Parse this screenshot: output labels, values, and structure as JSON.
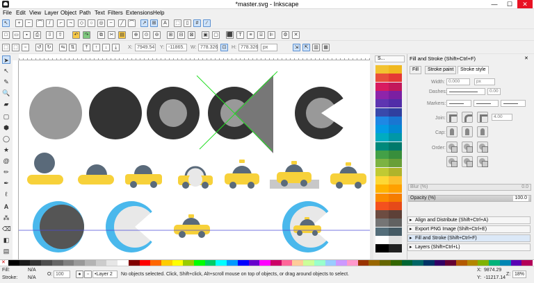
{
  "window": {
    "title": "*master.svg - Inkscape",
    "minimize": "—",
    "maximize": "☐",
    "close": "✕"
  },
  "menubar": [
    "File",
    "Edit",
    "View",
    "Layer",
    "Object",
    "Path",
    "Text",
    "Filters",
    "Extensions",
    "Help"
  ],
  "toolcontrols": {
    "x_label": "X:",
    "x_value": "7949.54",
    "y_label": "Y:",
    "y_value": "-11865.",
    "w_label": "W:",
    "w_value": "778.326",
    "h_label": "H:",
    "h_value": "778.326",
    "unit": "px"
  },
  "panel": {
    "header": "Fill and Stroke (Shift+Ctrl+F)",
    "tabs": [
      "Fill",
      "Stroke paint",
      "Stroke style"
    ],
    "active_tab": "Stroke style",
    "width_label": "Width:",
    "width_value": "0.000",
    "width_unit": "px",
    "dashes_label": "Dashes:",
    "dashes_value": "0.00",
    "markers_label": "Markers:",
    "join_label": "Join:",
    "join_value": "4.00",
    "cap_label": "Cap:",
    "order_label": "Order:",
    "blur_label": "Blur (%)",
    "blur_value": "0.0",
    "opacity_label": "Opacity (%)",
    "opacity_value": "100.0",
    "docks": [
      "Align and Distribute (Shift+Ctrl+A)",
      "Export PNG Image (Shift+Ctrl+E)",
      "Fill and Stroke (Shift+Ctrl+F)",
      "Layers (Shift+Ctrl+L)"
    ],
    "swatches_title": "S..."
  },
  "status": {
    "fill_label": "Fill:",
    "fill_value": "N/A",
    "stroke_label": "Stroke:",
    "stroke_value": "N/A",
    "opacity_label": "O:",
    "opacity_value": "100",
    "layer": "•Layer 2",
    "message": "No objects selected. Click, Shift+click, Alt+scroll mouse on top of objects, or drag around objects to select.",
    "x_label": "X:",
    "x_value": "9874.29",
    "y_label": "Y:",
    "y_value": "-11217.14",
    "zoom_label": "Z:",
    "zoom_value": "18%"
  },
  "colors": {
    "taxi_yellow": "#f7d13a",
    "dark_grey": "#333333",
    "mid_grey": "#999999",
    "taxi_window": "#5a6a7a",
    "ring_blue": "#4ab8ec",
    "guide_green": "#22dd22",
    "guide_blue": "#4a4ad8"
  },
  "swatch_colors": [
    "#f2c230",
    "#f0b820",
    "#e94e3b",
    "#e53935",
    "#d81b60",
    "#c2185b",
    "#8e24aa",
    "#7b1fa2",
    "#5e35b1",
    "#512da8",
    "#3949ab",
    "#303f9f",
    "#1e88e5",
    "#1976d2",
    "#039be5",
    "#0288d1",
    "#00acc1",
    "#0097a7",
    "#00897b",
    "#00796b",
    "#43a047",
    "#388e3c",
    "#7cb342",
    "#689f38",
    "#c0ca33",
    "#afb42b",
    "#fdd835",
    "#fbc02d",
    "#ffb300",
    "#ffa000",
    "#fb8c00",
    "#f57c00",
    "#f4511e",
    "#e64a19",
    "#6d4c41",
    "#5d4037",
    "#757575",
    "#616161",
    "#546e7a",
    "#455a64",
    "#ffffff",
    "#e0e0e0",
    "#000000",
    "#212121"
  ],
  "palette_colors": [
    "#000000",
    "#1a1a1a",
    "#333333",
    "#4d4d4d",
    "#666666",
    "#808080",
    "#999999",
    "#b3b3b3",
    "#cccccc",
    "#e6e6e6",
    "#ffffff",
    "#800000",
    "#ff0000",
    "#ff6600",
    "#ffcc00",
    "#ffff00",
    "#99cc00",
    "#00ff00",
    "#00cc66",
    "#00ffff",
    "#0099ff",
    "#0000ff",
    "#6600cc",
    "#ff00ff",
    "#cc0066",
    "#ff6699",
    "#ffcc99",
    "#ccff99",
    "#99ffcc",
    "#99ccff",
    "#cc99ff",
    "#ff99cc",
    "#993300",
    "#996600",
    "#666600",
    "#336600",
    "#006633",
    "#006666",
    "#003366",
    "#330066",
    "#660033",
    "#b35900",
    "#b38600",
    "#80b300",
    "#00b37a",
    "#0086b3",
    "#5900b3",
    "#b30059"
  ]
}
